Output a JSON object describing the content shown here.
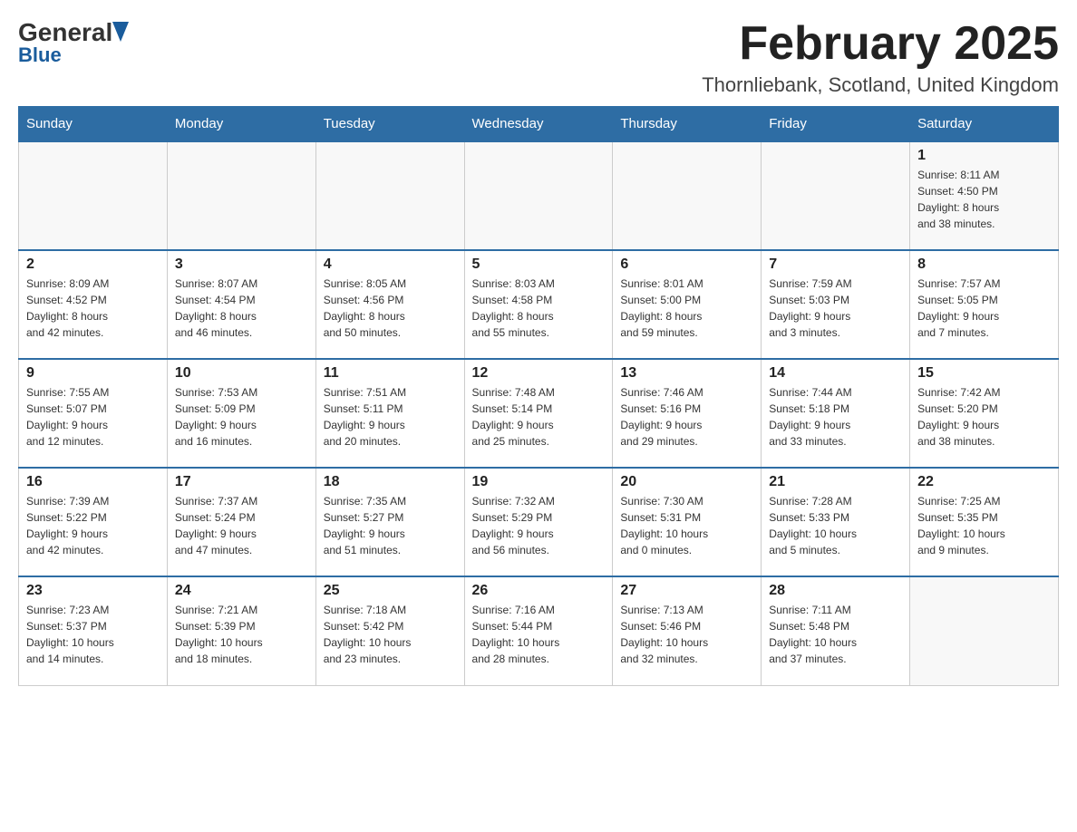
{
  "header": {
    "logo": {
      "general": "General",
      "blue": "Blue"
    },
    "title": "February 2025",
    "location": "Thornliebank, Scotland, United Kingdom"
  },
  "weekdays": [
    "Sunday",
    "Monday",
    "Tuesday",
    "Wednesday",
    "Thursday",
    "Friday",
    "Saturday"
  ],
  "weeks": [
    [
      {
        "day": "",
        "info": ""
      },
      {
        "day": "",
        "info": ""
      },
      {
        "day": "",
        "info": ""
      },
      {
        "day": "",
        "info": ""
      },
      {
        "day": "",
        "info": ""
      },
      {
        "day": "",
        "info": ""
      },
      {
        "day": "1",
        "info": "Sunrise: 8:11 AM\nSunset: 4:50 PM\nDaylight: 8 hours\nand 38 minutes."
      }
    ],
    [
      {
        "day": "2",
        "info": "Sunrise: 8:09 AM\nSunset: 4:52 PM\nDaylight: 8 hours\nand 42 minutes."
      },
      {
        "day": "3",
        "info": "Sunrise: 8:07 AM\nSunset: 4:54 PM\nDaylight: 8 hours\nand 46 minutes."
      },
      {
        "day": "4",
        "info": "Sunrise: 8:05 AM\nSunset: 4:56 PM\nDaylight: 8 hours\nand 50 minutes."
      },
      {
        "day": "5",
        "info": "Sunrise: 8:03 AM\nSunset: 4:58 PM\nDaylight: 8 hours\nand 55 minutes."
      },
      {
        "day": "6",
        "info": "Sunrise: 8:01 AM\nSunset: 5:00 PM\nDaylight: 8 hours\nand 59 minutes."
      },
      {
        "day": "7",
        "info": "Sunrise: 7:59 AM\nSunset: 5:03 PM\nDaylight: 9 hours\nand 3 minutes."
      },
      {
        "day": "8",
        "info": "Sunrise: 7:57 AM\nSunset: 5:05 PM\nDaylight: 9 hours\nand 7 minutes."
      }
    ],
    [
      {
        "day": "9",
        "info": "Sunrise: 7:55 AM\nSunset: 5:07 PM\nDaylight: 9 hours\nand 12 minutes."
      },
      {
        "day": "10",
        "info": "Sunrise: 7:53 AM\nSunset: 5:09 PM\nDaylight: 9 hours\nand 16 minutes."
      },
      {
        "day": "11",
        "info": "Sunrise: 7:51 AM\nSunset: 5:11 PM\nDaylight: 9 hours\nand 20 minutes."
      },
      {
        "day": "12",
        "info": "Sunrise: 7:48 AM\nSunset: 5:14 PM\nDaylight: 9 hours\nand 25 minutes."
      },
      {
        "day": "13",
        "info": "Sunrise: 7:46 AM\nSunset: 5:16 PM\nDaylight: 9 hours\nand 29 minutes."
      },
      {
        "day": "14",
        "info": "Sunrise: 7:44 AM\nSunset: 5:18 PM\nDaylight: 9 hours\nand 33 minutes."
      },
      {
        "day": "15",
        "info": "Sunrise: 7:42 AM\nSunset: 5:20 PM\nDaylight: 9 hours\nand 38 minutes."
      }
    ],
    [
      {
        "day": "16",
        "info": "Sunrise: 7:39 AM\nSunset: 5:22 PM\nDaylight: 9 hours\nand 42 minutes."
      },
      {
        "day": "17",
        "info": "Sunrise: 7:37 AM\nSunset: 5:24 PM\nDaylight: 9 hours\nand 47 minutes."
      },
      {
        "day": "18",
        "info": "Sunrise: 7:35 AM\nSunset: 5:27 PM\nDaylight: 9 hours\nand 51 minutes."
      },
      {
        "day": "19",
        "info": "Sunrise: 7:32 AM\nSunset: 5:29 PM\nDaylight: 9 hours\nand 56 minutes."
      },
      {
        "day": "20",
        "info": "Sunrise: 7:30 AM\nSunset: 5:31 PM\nDaylight: 10 hours\nand 0 minutes."
      },
      {
        "day": "21",
        "info": "Sunrise: 7:28 AM\nSunset: 5:33 PM\nDaylight: 10 hours\nand 5 minutes."
      },
      {
        "day": "22",
        "info": "Sunrise: 7:25 AM\nSunset: 5:35 PM\nDaylight: 10 hours\nand 9 minutes."
      }
    ],
    [
      {
        "day": "23",
        "info": "Sunrise: 7:23 AM\nSunset: 5:37 PM\nDaylight: 10 hours\nand 14 minutes."
      },
      {
        "day": "24",
        "info": "Sunrise: 7:21 AM\nSunset: 5:39 PM\nDaylight: 10 hours\nand 18 minutes."
      },
      {
        "day": "25",
        "info": "Sunrise: 7:18 AM\nSunset: 5:42 PM\nDaylight: 10 hours\nand 23 minutes."
      },
      {
        "day": "26",
        "info": "Sunrise: 7:16 AM\nSunset: 5:44 PM\nDaylight: 10 hours\nand 28 minutes."
      },
      {
        "day": "27",
        "info": "Sunrise: 7:13 AM\nSunset: 5:46 PM\nDaylight: 10 hours\nand 32 minutes."
      },
      {
        "day": "28",
        "info": "Sunrise: 7:11 AM\nSunset: 5:48 PM\nDaylight: 10 hours\nand 37 minutes."
      },
      {
        "day": "",
        "info": ""
      }
    ]
  ]
}
